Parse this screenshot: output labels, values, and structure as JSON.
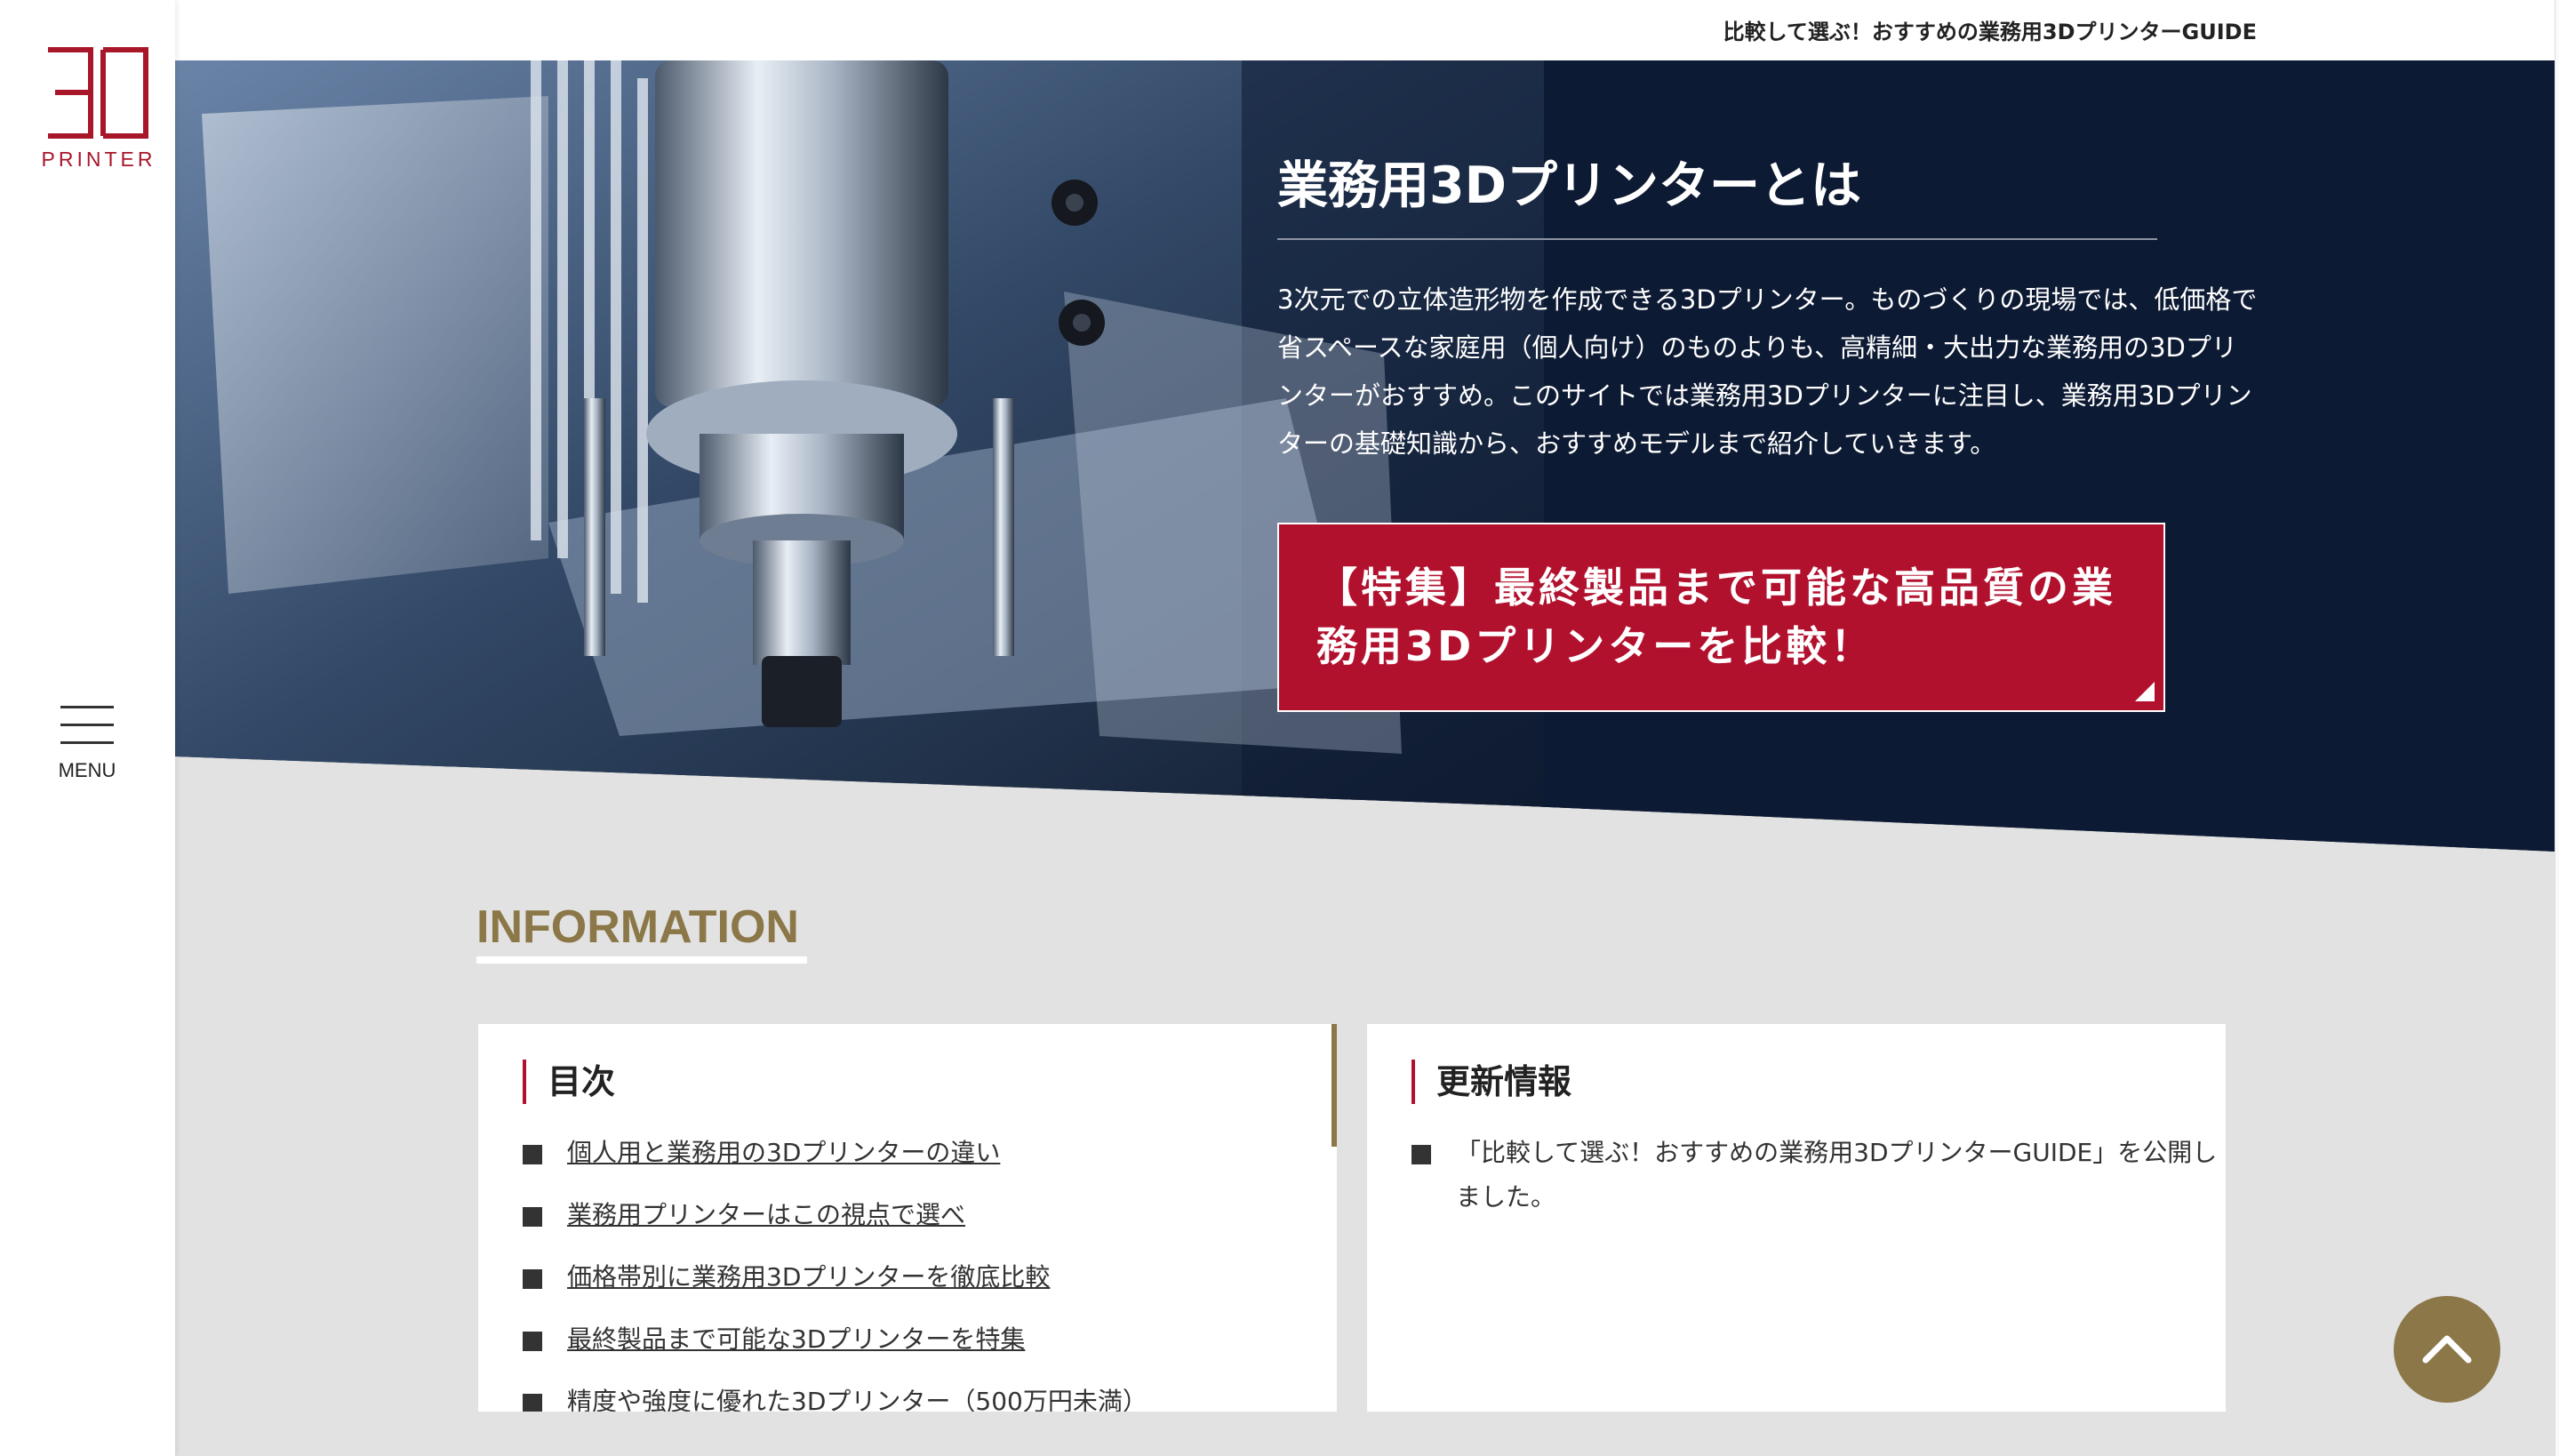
{
  "brand": {
    "logo_text": "PRINTER",
    "logo_mark": "3D",
    "accent_color": "#b2112e",
    "gold_color": "#8b7748",
    "navy_color": "#0d1a33"
  },
  "sidebar": {
    "menu_label": "MENU",
    "menu_icon": "hamburger-icon"
  },
  "header": {
    "site_title": "比較して選ぶ！おすすめの業務用3DプリンターGUIDE"
  },
  "hero": {
    "title": "業務用3Dプリンターとは",
    "description": "3次元での立体造形物を作成できる3Dプリンター。ものづくりの現場では、低価格で省スペースな家庭用（個人向け）のものよりも、高精細・大出力な業務用の3Dプリンターがおすすめ。このサイトでは業務用3Dプリンターに注目し、業務用3Dプリンターの基礎知識から、おすすめモデルまで紹介していきます。",
    "cta_label": "【特集】最終製品まで可能な高品質の業務用3Dプリンターを比較！"
  },
  "information": {
    "heading": "INFORMATION",
    "toc": {
      "title": "目次",
      "items": [
        "個人用と業務用の3Dプリンターの違い",
        "業務用プリンターはこの視点で選べ",
        "価格帯別に業務用3Dプリンターを徹底比較",
        "最終製品まで可能な3Dプリンターを特集",
        "精度や強度に優れた3Dプリンター（500万円未満）"
      ]
    },
    "news": {
      "title": "更新情報",
      "items": [
        "「比較して選ぶ！おすすめの業務用3DプリンターGUIDE」を公開しました。"
      ]
    }
  },
  "back_to_top": {
    "icon": "chevron-up-icon"
  }
}
